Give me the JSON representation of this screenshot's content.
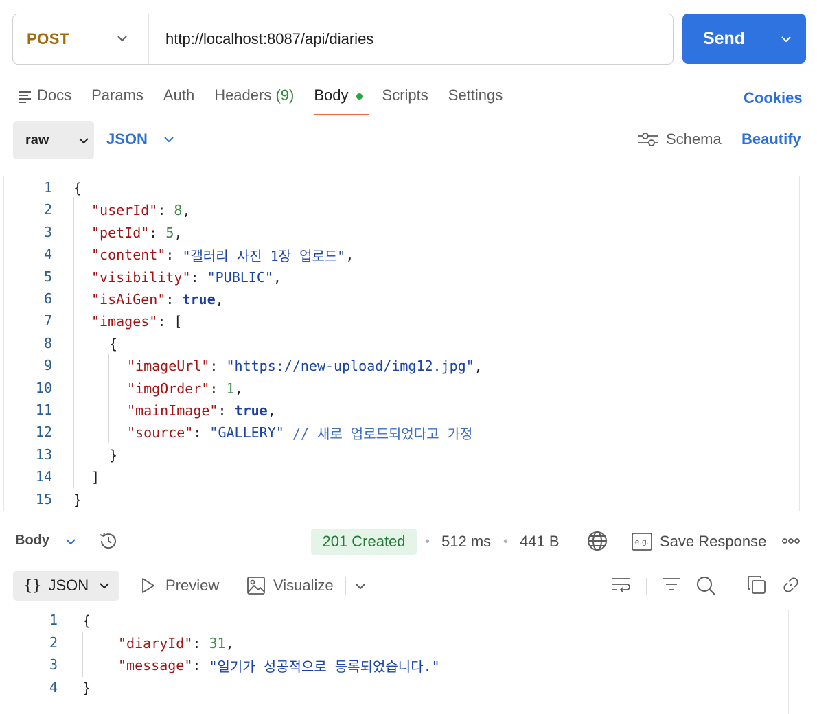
{
  "request": {
    "method": "POST",
    "url": "http://localhost:8087/api/diaries",
    "send_label": "Send"
  },
  "tabs": [
    {
      "label": "Docs"
    },
    {
      "label": "Params"
    },
    {
      "label": "Auth"
    },
    {
      "label": "Headers",
      "count": "(9)"
    },
    {
      "label": "Body",
      "active": true
    },
    {
      "label": "Scripts"
    },
    {
      "label": "Settings"
    }
  ],
  "cookies_label": "Cookies",
  "body_options": {
    "mode": "raw",
    "language": "JSON",
    "schema_label": "Schema",
    "beautify_label": "Beautify"
  },
  "request_body": {
    "line_numbers": [
      "1",
      "2",
      "3",
      "4",
      "5",
      "6",
      "7",
      "8",
      "9",
      "10",
      "11",
      "12",
      "13",
      "14",
      "15"
    ],
    "lines": [
      [
        {
          "t": "p",
          "v": "{"
        }
      ],
      [
        {
          "t": "k",
          "v": "\"userId\""
        },
        {
          "t": "p",
          "v": ": "
        },
        {
          "t": "n",
          "v": "8"
        },
        {
          "t": "p",
          "v": ","
        }
      ],
      [
        {
          "t": "k",
          "v": "\"petId\""
        },
        {
          "t": "p",
          "v": ": "
        },
        {
          "t": "n",
          "v": "5"
        },
        {
          "t": "p",
          "v": ","
        }
      ],
      [
        {
          "t": "k",
          "v": "\"content\""
        },
        {
          "t": "p",
          "v": ": "
        },
        {
          "t": "s",
          "v": "\"갤러리 사진 1장 업로드\""
        },
        {
          "t": "p",
          "v": ","
        }
      ],
      [
        {
          "t": "k",
          "v": "\"visibility\""
        },
        {
          "t": "p",
          "v": ": "
        },
        {
          "t": "s",
          "v": "\"PUBLIC\""
        },
        {
          "t": "p",
          "v": ","
        }
      ],
      [
        {
          "t": "k",
          "v": "\"isAiGen\""
        },
        {
          "t": "p",
          "v": ": "
        },
        {
          "t": "b",
          "v": "true"
        },
        {
          "t": "p",
          "v": ","
        }
      ],
      [
        {
          "t": "k",
          "v": "\"images\""
        },
        {
          "t": "p",
          "v": ": ["
        }
      ],
      [
        {
          "t": "p",
          "v": "{"
        }
      ],
      [
        {
          "t": "k",
          "v": "\"imageUrl\""
        },
        {
          "t": "p",
          "v": ": "
        },
        {
          "t": "s",
          "v": "\"https://new-upload/img12.jpg\""
        },
        {
          "t": "p",
          "v": ","
        }
      ],
      [
        {
          "t": "k",
          "v": "\"imgOrder\""
        },
        {
          "t": "p",
          "v": ": "
        },
        {
          "t": "n",
          "v": "1"
        },
        {
          "t": "p",
          "v": ","
        }
      ],
      [
        {
          "t": "k",
          "v": "\"mainImage\""
        },
        {
          "t": "p",
          "v": ": "
        },
        {
          "t": "b",
          "v": "true"
        },
        {
          "t": "p",
          "v": ","
        }
      ],
      [
        {
          "t": "k",
          "v": "\"source\""
        },
        {
          "t": "p",
          "v": ": "
        },
        {
          "t": "s",
          "v": "\"GALLERY\""
        },
        {
          "t": "p",
          "v": " "
        },
        {
          "t": "c",
          "v": "// 새로 업로드되었다고 가정"
        }
      ],
      [
        {
          "t": "p",
          "v": "}"
        }
      ],
      [
        {
          "t": "p",
          "v": "]"
        }
      ],
      [
        {
          "t": "p",
          "v": "}"
        }
      ]
    ]
  },
  "response": {
    "body_label": "Body",
    "status": "201 Created",
    "time": "512 ms",
    "size": "441 B",
    "save_label": "Save Response",
    "format": "JSON",
    "preview_label": "Preview",
    "visualize_label": "Visualize",
    "line_numbers": [
      "1",
      "2",
      "3",
      "4"
    ],
    "lines": [
      [
        {
          "t": "p",
          "v": "{"
        }
      ],
      [
        {
          "t": "k",
          "v": "\"diaryId\""
        },
        {
          "t": "p",
          "v": ": "
        },
        {
          "t": "n",
          "v": "31"
        },
        {
          "t": "p",
          "v": ","
        }
      ],
      [
        {
          "t": "k",
          "v": "\"message\""
        },
        {
          "t": "p",
          "v": ": "
        },
        {
          "t": "s",
          "v": "\"일기가 성공적으로 등록되었습니다.\""
        }
      ],
      [
        {
          "t": "p",
          "v": "}"
        }
      ]
    ]
  },
  "icons": {
    "docs": "docs-icon",
    "method_chevron": "chevron-down-icon",
    "send_dropdown": "chevron-down-icon",
    "schema": "sliders-icon",
    "history": "history-icon",
    "globe": "globe-icon",
    "example": "example-icon",
    "more": "more-icon",
    "preview": "play-icon",
    "visualize": "image-icon",
    "wrap": "wrap-icon",
    "filter": "filter-icon",
    "search": "search-icon",
    "copy": "copy-icon",
    "link": "link-icon"
  }
}
